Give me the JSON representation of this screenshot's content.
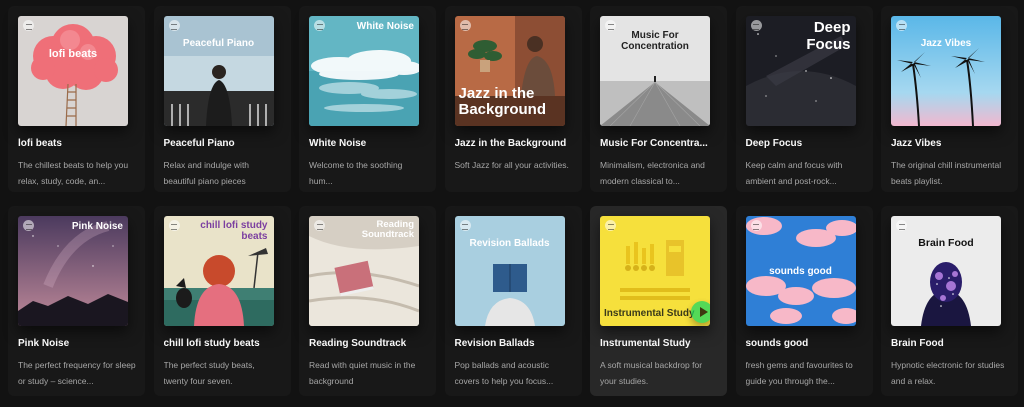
{
  "playlists": [
    {
      "title": "lofi beats",
      "cover_text": "lofi beats",
      "description": "The chillest beats to help you relax, study, code, an..."
    },
    {
      "title": "Peaceful Piano",
      "cover_text": "Peaceful Piano",
      "description": "Relax and indulge with beautiful piano pieces"
    },
    {
      "title": "White Noise",
      "cover_text": "White Noise",
      "description": "Welcome to the soothing hum..."
    },
    {
      "title": "Jazz in the Background",
      "cover_text": "Jazz in the Background",
      "description": "Soft Jazz for all your activities."
    },
    {
      "title": "Music For Concentra...",
      "cover_text": "Music For Concentration",
      "description": "Minimalism, electronica and modern classical to..."
    },
    {
      "title": "Deep Focus",
      "cover_text": "Deep Focus",
      "description": "Keep calm and focus with ambient and post-rock..."
    },
    {
      "title": "Jazz Vibes",
      "cover_text": "Jazz Vibes",
      "description": "The original chill instrumental beats playlist."
    },
    {
      "title": "Pink Noise",
      "cover_text": "Pink Noise",
      "description": "The perfect frequency for sleep or study – science..."
    },
    {
      "title": "chill lofi study beats",
      "cover_text": "chill lofi study beats",
      "description": "The perfect study beats, twenty four seven."
    },
    {
      "title": "Reading Soundtrack",
      "cover_text": "Reading Soundtrack",
      "description": "Read with quiet music in the background"
    },
    {
      "title": "Revision Ballads",
      "cover_text": "Revision Ballads",
      "description": "Pop ballads and acoustic covers to help you focus..."
    },
    {
      "title": "Instrumental Study",
      "cover_text": "Instrumental Study",
      "description": "A soft musical backdrop for your studies."
    },
    {
      "title": "sounds good",
      "cover_text": "sounds good",
      "description": "fresh gems and favourites to guide you through the..."
    },
    {
      "title": "Brain Food",
      "cover_text": "Brain Food",
      "description": "Hypnotic electronic for studies and a relax."
    }
  ],
  "hovered_card": "Instrumental Study",
  "colors": {
    "background": "#121212",
    "card": "#181818",
    "card_hover": "#282828",
    "play_button": "#1ed760"
  }
}
